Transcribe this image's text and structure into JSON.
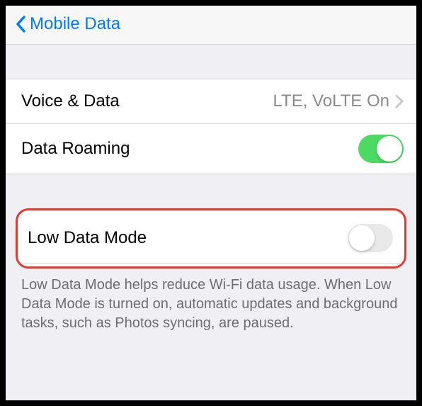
{
  "nav": {
    "back_label": "Mobile Data"
  },
  "group1": {
    "voice_data": {
      "label": "Voice & Data",
      "value": "LTE, VoLTE On"
    },
    "data_roaming": {
      "label": "Data Roaming",
      "enabled": true
    }
  },
  "group2": {
    "low_data_mode": {
      "label": "Low Data Mode",
      "enabled": false
    }
  },
  "footer": {
    "text": "Low Data Mode helps reduce Wi-Fi data usage. When Low Data Mode is turned on, automatic updates and background tasks, such as Photos syncing, are paused."
  }
}
